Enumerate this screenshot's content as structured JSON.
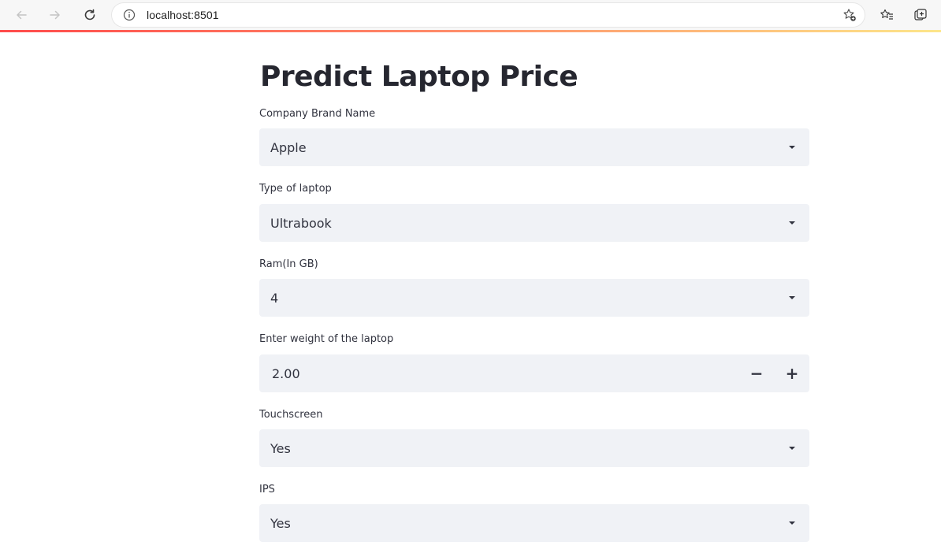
{
  "browser": {
    "url": "localhost:8501",
    "back_icon": "arrow-left-icon",
    "forward_icon": "arrow-right-icon",
    "refresh_icon": "refresh-icon",
    "info_icon": "info-icon",
    "favorite_icon": "star-add-icon",
    "favorites_icon": "favorites-icon",
    "collections_icon": "collections-icon"
  },
  "app": {
    "title": "Predict Laptop Price",
    "accent_colors": [
      "#ff4b4b",
      "#fde68a"
    ],
    "fields": {
      "company": {
        "label": "Company Brand Name",
        "value": "Apple"
      },
      "type": {
        "label": "Type of laptop",
        "value": "Ultrabook"
      },
      "ram": {
        "label": "Ram(In GB)",
        "value": "4"
      },
      "weight": {
        "label": "Enter weight of the laptop",
        "value": "2.00",
        "decrement": "−",
        "increment": "+"
      },
      "touchscreen": {
        "label": "Touchscreen",
        "value": "Yes"
      },
      "ips": {
        "label": "IPS",
        "value": "Yes"
      }
    }
  }
}
